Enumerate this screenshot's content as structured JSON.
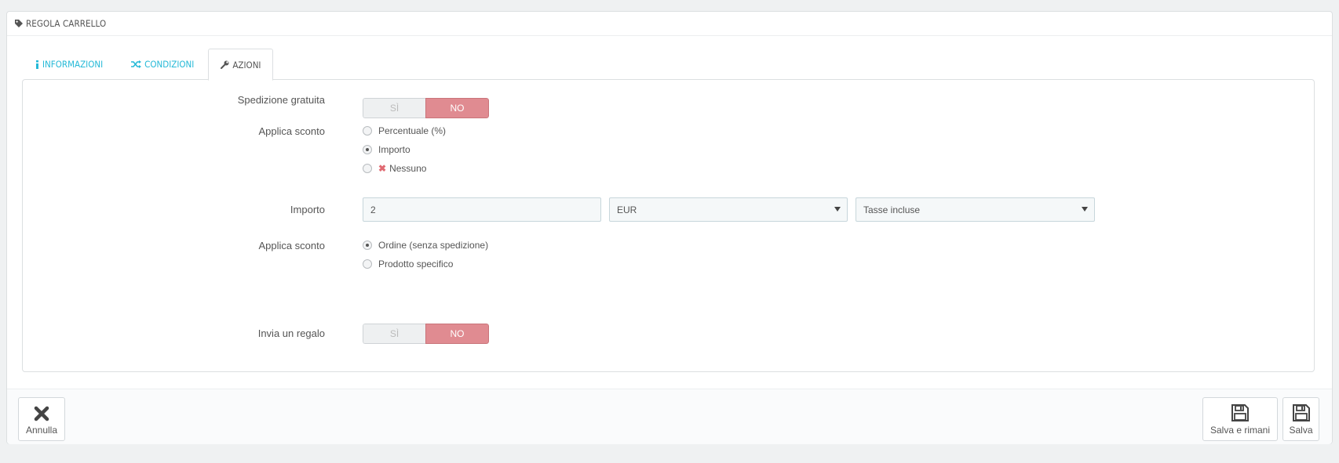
{
  "panel": {
    "title": "REGOLA CARRELLO",
    "icon": "tag-icon"
  },
  "tabs": [
    {
      "label": "INFORMAZIONI",
      "icon": "info-icon"
    },
    {
      "label": "CONDIZIONI",
      "icon": "random-icon"
    },
    {
      "label": "AZIONI",
      "icon": "wrench-icon"
    }
  ],
  "free_shipping": {
    "label": "Spedizione gratuita",
    "yes": "SÌ",
    "no": "NO"
  },
  "apply_discount": {
    "label": "Applica sconto",
    "options": [
      "Percentuale (%)",
      "Importo",
      "Nessuno"
    ],
    "selected": "Importo"
  },
  "amount": {
    "label": "Importo",
    "value": "2",
    "currency": "EUR",
    "tax": "Tasse incluse"
  },
  "apply_discount_to": {
    "label": "Applica sconto",
    "options": [
      "Ordine (senza spedizione)",
      "Prodotto specifico"
    ],
    "selected": "Ordine (senza spedizione)"
  },
  "gift": {
    "label": "Invia un regalo",
    "yes": "SÌ",
    "no": "NO"
  },
  "footer": {
    "cancel_label": "Annulla",
    "save_stay_label": "Salva e rimani",
    "save_label": "Salva"
  },
  "colors": {
    "accent": "#25b9d7",
    "no_active": "#e08b91"
  }
}
